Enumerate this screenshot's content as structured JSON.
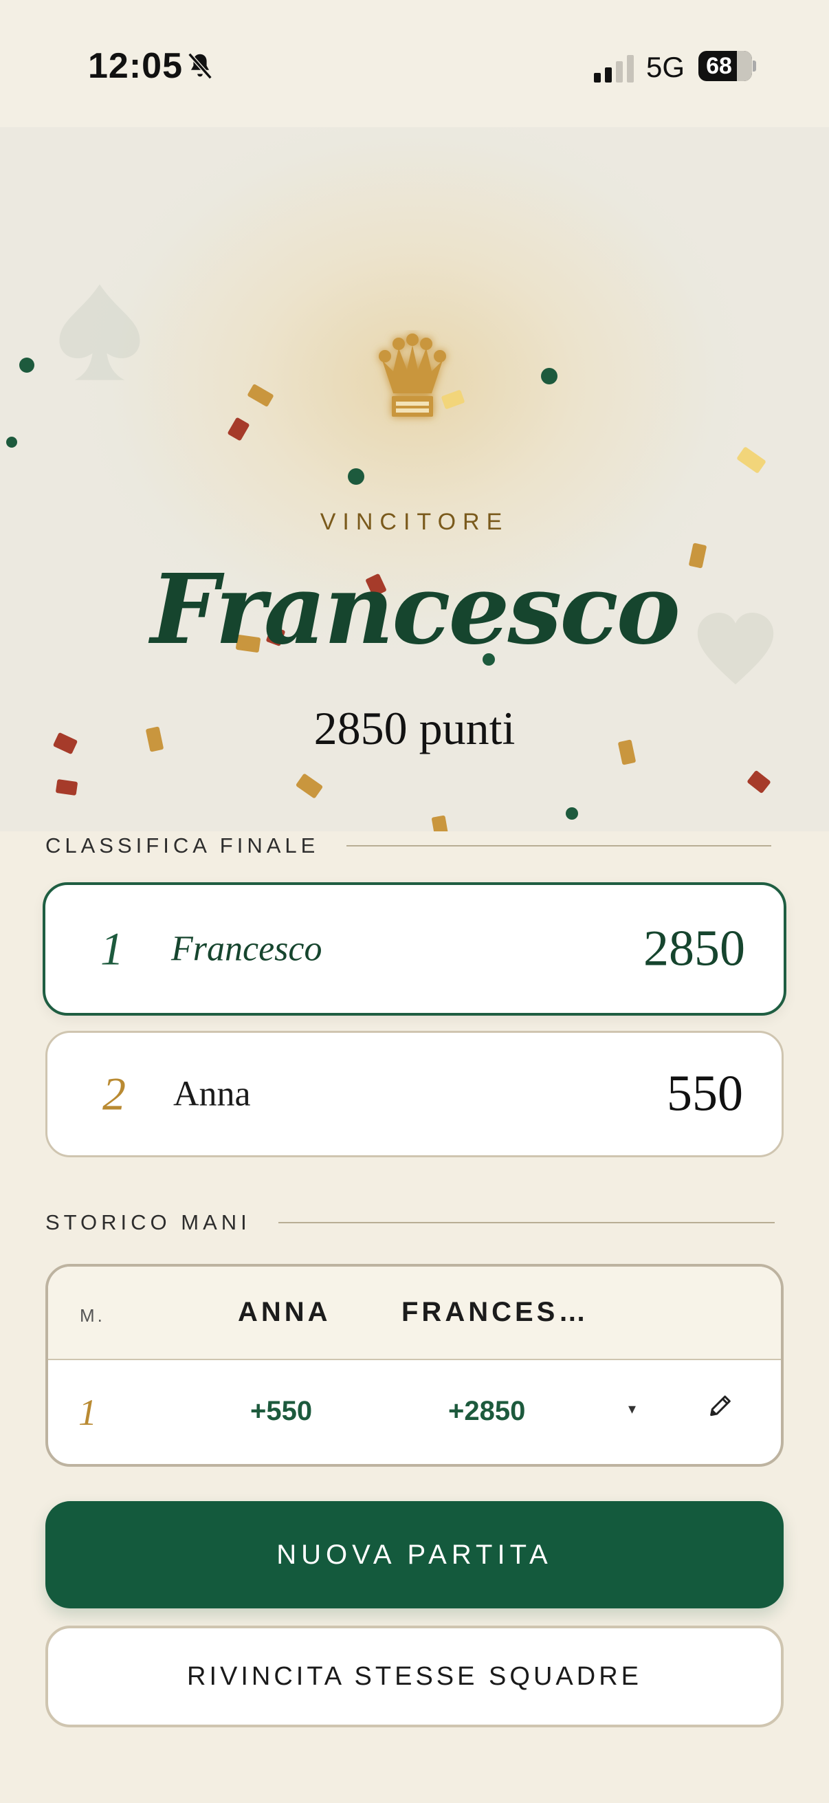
{
  "status_bar": {
    "time": "12:05",
    "network": "5G",
    "battery": "68",
    "battery_level": 0.68,
    "icons": [
      "bell-slash-icon",
      "signal-icon",
      "battery-icon"
    ]
  },
  "hero": {
    "crown_icon": "crown-icon",
    "label": "VINCITORE",
    "winner_name": "Francesco",
    "winner_points": "2850 punti",
    "decor_icons": [
      "spade-icon",
      "heart-icon"
    ]
  },
  "ranking": {
    "title": "CLASSIFICA FINALE",
    "entries": [
      {
        "position": "1",
        "name": "Francesco",
        "score": "2850"
      },
      {
        "position": "2",
        "name": "Anna",
        "score": "550"
      }
    ]
  },
  "history": {
    "title": "STORICO MANI",
    "headers": {
      "hand": "M.",
      "player1": "ANNA",
      "player2": "FRANCES…"
    },
    "rows": [
      {
        "hand": "1",
        "player1": "+550",
        "player2": "+2850",
        "expand": "▾",
        "edit_icon": "pencil-icon"
      }
    ]
  },
  "actions": {
    "new_game": "NUOVA PARTITA",
    "rematch": "RIVINCITA STESSE SQUADRE"
  },
  "colors": {
    "background": "#f3eee2",
    "primary_green": "#145a3d",
    "winner_green": "#16452e",
    "gold": "#c9963e",
    "confetti_red": "#a63b2a",
    "confetti_yellow": "#f2d57a"
  }
}
